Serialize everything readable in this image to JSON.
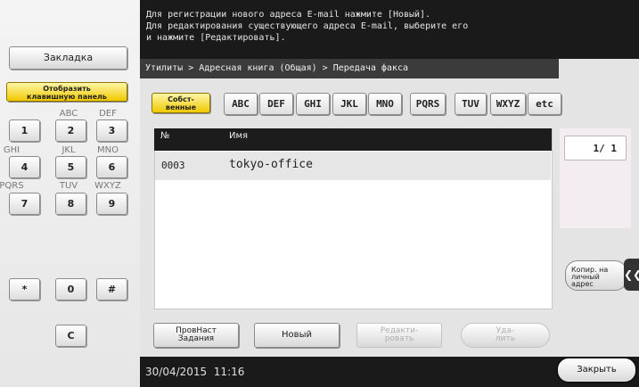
{
  "message": {
    "lines": [
      "Для регистрации нового адреса E-mail нажмите [Новый].",
      "Для редактирования существующего адреса E-mail, выберите его",
      "и нажмите [Редактировать]."
    ]
  },
  "sidebar": {
    "bookmark_label": "Закладка",
    "show_keyboard_label_1": "Отобразить",
    "show_keyboard_label_2": "клавишную панель",
    "keypad": {
      "k1": "1",
      "k2": "2",
      "k3": "3",
      "k4": "4",
      "k5": "5",
      "k6": "6",
      "k7": "7",
      "k8": "8",
      "k9": "9",
      "star": "*",
      "k0": "0",
      "hash": "#",
      "clear": "C"
    },
    "letters": {
      "l2": "ABC",
      "l3": "DEF",
      "l4": "GHI",
      "l5": "JKL",
      "l6": "MNO",
      "l7": "PQRS",
      "l8": "TUV",
      "l9": "WXYZ"
    }
  },
  "breadcrumb": "Утилиты > Адресная книга (Общая) > Передача факса",
  "index_tabs": {
    "own_1": "Собст-",
    "own_2": "венные",
    "abc": "ABC",
    "def": "DEF",
    "ghi": "GHI",
    "jkl": "JKL",
    "mno": "MNO",
    "pqrs": "PQRS",
    "tuv": "TUV",
    "wxyz": "WXYZ",
    "etc": "etc"
  },
  "table": {
    "col_no": "№",
    "col_name": "Имя",
    "rows": [
      {
        "no": "0003",
        "name": "tokyo-office"
      }
    ]
  },
  "pager": "1/ 1",
  "copy_button": "Копир. на\nличный\nадрес",
  "actions": {
    "job_settings_1": "ПровНаст",
    "job_settings_2": "Задания",
    "new": "Новый",
    "edit_1": "Редакти-",
    "edit_2": "ровать",
    "delete_1": "Уда-",
    "delete_2": "лить"
  },
  "status": {
    "datetime": "30/04/2015  11:16",
    "close_label": "Закрыть"
  }
}
